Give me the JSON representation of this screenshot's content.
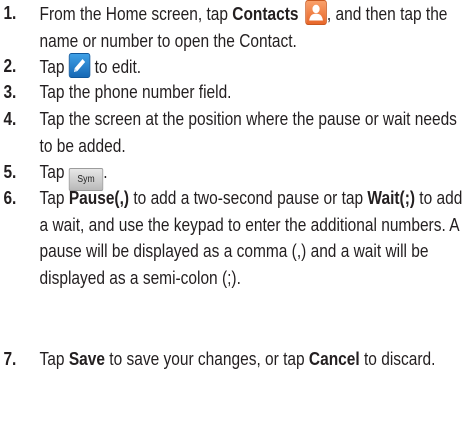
{
  "steps": [
    {
      "number": "1.",
      "parts": [
        "From the Home screen, tap ",
        "Contacts",
        ", and then tap the name or number to open the Contact."
      ],
      "icons": [
        "contacts-icon"
      ]
    },
    {
      "number": "2.",
      "parts": [
        "Tap ",
        " to edit."
      ],
      "icons": [
        "edit-pencil-icon"
      ]
    },
    {
      "number": "3.",
      "parts": [
        "Tap the phone number field."
      ]
    },
    {
      "number": "4.",
      "parts": [
        "Tap the screen at the position where the pause or wait needs to be added."
      ]
    },
    {
      "number": "5.",
      "parts": [
        "Tap ",
        "Sym",
        "."
      ],
      "icons": [
        "sym-key"
      ]
    },
    {
      "number": "6.",
      "parts": [
        "Tap ",
        "Pause(,)",
        " to add a two-second pause or tap ",
        "Wait(;)",
        " to add a wait, and use the keypad to enter the additional numbers. A pause will be displayed as a comma (,) and a wait will be displayed as a semi-colon (;)."
      ]
    },
    {
      "number": "7.",
      "parts": [
        "Tap ",
        "Save",
        " to save your changes, or tap ",
        "Cancel",
        " to discard."
      ]
    }
  ],
  "colors": {
    "text": "#231f20",
    "contacts_icon": "#e8672a",
    "edit_icon": "#1668b5"
  }
}
